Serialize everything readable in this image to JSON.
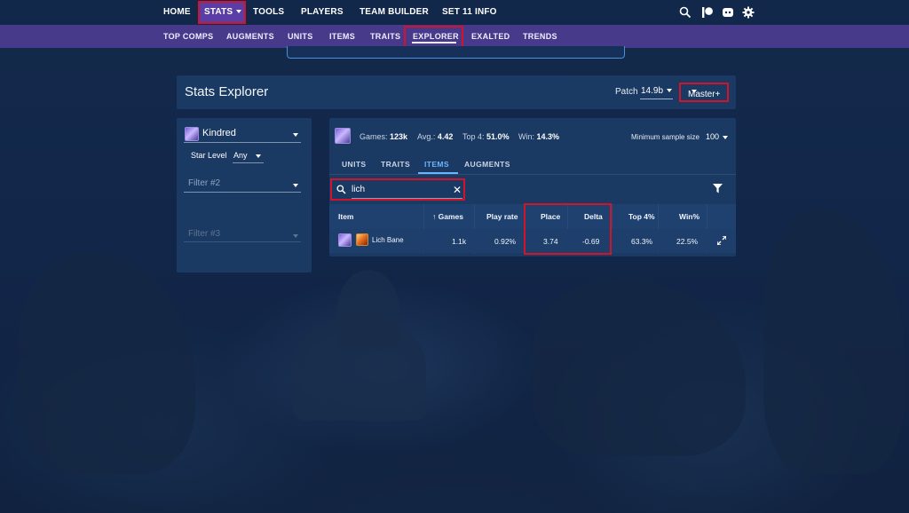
{
  "topnav": {
    "items": [
      "HOME",
      "STATS",
      "TOOLS",
      "PLAYERS",
      "TEAM BUILDER",
      "SET 11 INFO"
    ],
    "icons": [
      "search-icon",
      "patreon-icon",
      "discord-icon",
      "gear-icon"
    ]
  },
  "subnav": {
    "items": [
      "TOP COMPS",
      "AUGMENTS",
      "UNITS",
      "ITEMS",
      "TRAITS",
      "EXPLORER",
      "EXALTED",
      "TRENDS"
    ],
    "active": "EXPLORER"
  },
  "header": {
    "title": "Stats Explorer",
    "patch_label": "Patch",
    "patch_value": "14.9b",
    "rank_value": "Master+"
  },
  "filters": {
    "filter1_value": "Kindred",
    "star_level_label": "Star Level",
    "star_level_value": "Any",
    "filter2_placeholder": "Filter #2",
    "filter3_placeholder": "Filter #3"
  },
  "summary": {
    "games_label": "Games:",
    "games_value": "123k",
    "avg_label": "Avg.:",
    "avg_value": "4.42",
    "top4_label": "Top 4:",
    "top4_value": "51.0%",
    "win_label": "Win:",
    "win_value": "14.3%",
    "min_sample_label": "Minimum sample size",
    "min_sample_value": "100"
  },
  "tabs": [
    "UNITS",
    "TRAITS",
    "ITEMS",
    "AUGMENTS"
  ],
  "active_tab": "ITEMS",
  "search": {
    "value": "lich"
  },
  "table": {
    "columns": [
      "Item",
      "↑ Games",
      "Play rate",
      "Place",
      "Delta",
      "Top 4%",
      "Win%"
    ],
    "rows": [
      {
        "item": "Lich Bane",
        "games": "1.1k",
        "play_rate": "0.92%",
        "place": "3.74",
        "delta": "-0.69",
        "top4": "63.3%",
        "win": "22.5%"
      }
    ]
  },
  "colors": {
    "highlight": "#d3132a",
    "accent": "#6cb6ff",
    "topnav_bg": "#12284a",
    "subnav_bg": "#473a8a",
    "panel_bg": "#1b3a63"
  }
}
